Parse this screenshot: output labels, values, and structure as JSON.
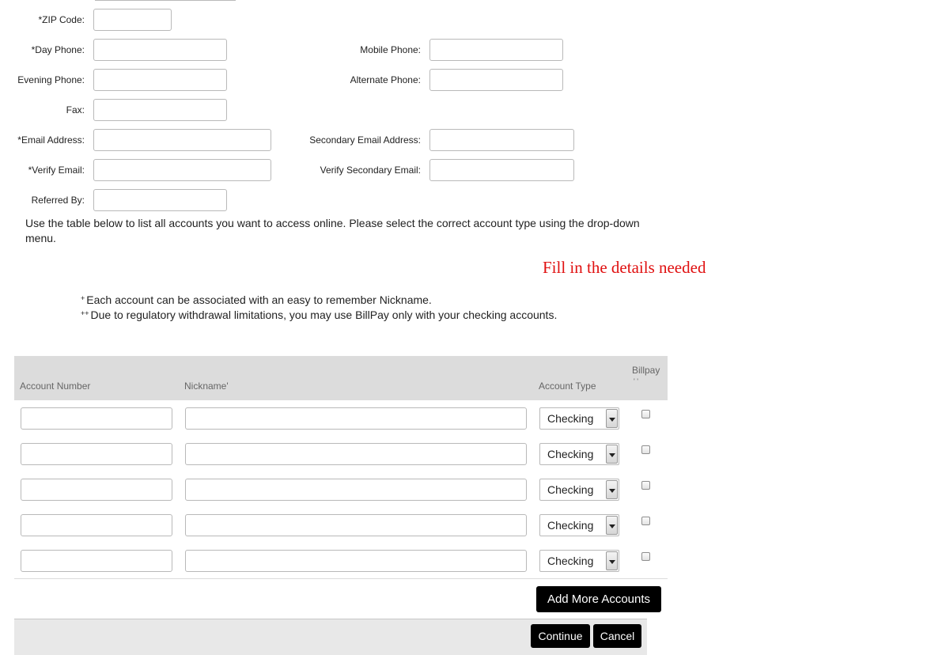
{
  "form": {
    "zip_label": "*ZIP Code:",
    "day_phone_label": "*Day Phone:",
    "mobile_phone_label": "Mobile Phone:",
    "evening_phone_label": "Evening Phone:",
    "alternate_phone_label": "Alternate Phone:",
    "fax_label": "Fax:",
    "email_label": "*Email Address:",
    "secondary_email_label": "Secondary Email Address:",
    "verify_email_label": "*Verify Email:",
    "verify_secondary_email_label": "Verify Secondary Email:",
    "referred_by_label": "Referred By:"
  },
  "instructions": "Use the table below to list all accounts you want to access online. Please select the correct account type using the drop-down menu.",
  "callout": "Fill in the details needed",
  "notes": {
    "note1_marker": "+",
    "note1": "Each account can be associated with an easy to remember Nickname.",
    "note2_marker": "++",
    "note2": "Due to regulatory withdrawal limitations, you may use BillPay only with your checking accounts."
  },
  "table": {
    "headers": {
      "account_number": "Account Number",
      "nickname": "Nickname'",
      "account_type": "Account Type",
      "billpay": "Billpay",
      "billpay_marker": "' '"
    },
    "rows": [
      {
        "account_type": "Checking",
        "billpay_checked": false
      },
      {
        "account_type": "Checking",
        "billpay_checked": false
      },
      {
        "account_type": "Checking",
        "billpay_checked": false
      },
      {
        "account_type": "Checking",
        "billpay_checked": false
      },
      {
        "account_type": "Checking",
        "billpay_checked": false
      }
    ]
  },
  "buttons": {
    "add_more": "Add More Accounts",
    "continue": "Continue",
    "cancel": "Cancel"
  }
}
